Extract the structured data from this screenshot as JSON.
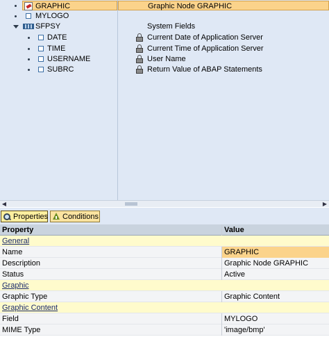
{
  "tree": {
    "rows": [
      {
        "name": "GRAPHIC",
        "description": "Graphic Node GRAPHIC",
        "selected": true,
        "icon": "graphic-node-icon"
      },
      {
        "name": "MYLOGO",
        "description": "",
        "selected": false,
        "icon": "node-icon"
      },
      {
        "name": "SFPSY",
        "description": "System Fields",
        "selected": false,
        "icon": "structure-icon"
      },
      {
        "name": "DATE",
        "description": "Current Date of Application Server",
        "selected": false,
        "icon": "lock-icon"
      },
      {
        "name": "TIME",
        "description": "Current Time of Application Server",
        "selected": false,
        "icon": "lock-icon"
      },
      {
        "name": "USERNAME",
        "description": "User Name",
        "selected": false,
        "icon": "lock-icon"
      },
      {
        "name": "SUBRC",
        "description": "Return Value of ABAP Statements",
        "selected": false,
        "icon": "lock-icon"
      }
    ]
  },
  "scrollbar": {
    "left_arrow": "◀",
    "right_arrow": "▶"
  },
  "tabs": [
    {
      "label": "Properties",
      "icon": "magnifier-icon",
      "active": true
    },
    {
      "label": "Conditions",
      "icon": "conditions-icon",
      "active": false
    }
  ],
  "properties": {
    "header": {
      "property": "Property",
      "value": "Value"
    },
    "rows": [
      {
        "type": "group",
        "property": "General",
        "value": ""
      },
      {
        "type": "data",
        "property": "Name",
        "value": "GRAPHIC",
        "highlight": true
      },
      {
        "type": "data",
        "property": "Description",
        "value": "Graphic Node GRAPHIC"
      },
      {
        "type": "data",
        "property": "Status",
        "value": "Active"
      },
      {
        "type": "group",
        "property": "Graphic",
        "value": ""
      },
      {
        "type": "data",
        "property": "Graphic Type",
        "value": "Graphic Content"
      },
      {
        "type": "group",
        "property": "Graphic Content",
        "value": ""
      },
      {
        "type": "data",
        "property": "Field",
        "value": "MYLOGO"
      },
      {
        "type": "data",
        "property": "MIME Type",
        "value": "'image/bmp'"
      }
    ]
  },
  "colors": {
    "tree_background": "#dfe8f5",
    "selection": "#fbd38b",
    "group_row": "#fffbcc",
    "header_row": "#c9d3de",
    "tab": "#fbe3a0"
  }
}
